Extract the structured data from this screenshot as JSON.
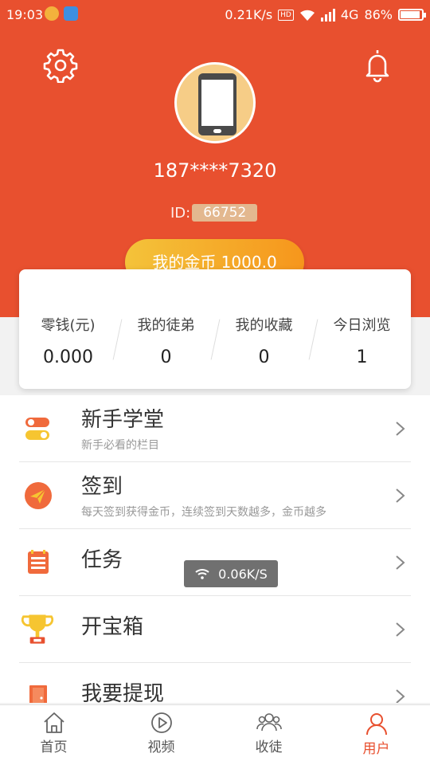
{
  "status_bar": {
    "time": "19:03",
    "speed": "0.21K/s",
    "hd": "HD",
    "network": "4G",
    "battery": "86%"
  },
  "profile": {
    "phone": "187****7320",
    "id_label": "ID:",
    "id_value": "66752"
  },
  "coins": {
    "label": "我的金币 1000.0"
  },
  "stats": [
    {
      "label": "零钱(元)",
      "value": "0.000"
    },
    {
      "label": "我的徒弟",
      "value": "0"
    },
    {
      "label": "我的收藏",
      "value": "0"
    },
    {
      "label": "今日浏览",
      "value": "1"
    }
  ],
  "menu": [
    {
      "title": "新手学堂",
      "sub": "新手必看的栏目",
      "icon": "toggle-icon"
    },
    {
      "title": "签到",
      "sub": "每天签到获得金币，连续签到天数越多，金币越多",
      "icon": "paper-plane-icon"
    },
    {
      "title": "任务",
      "sub": "",
      "icon": "task-list-icon"
    },
    {
      "title": "开宝箱",
      "sub": "",
      "icon": "trophy-icon"
    },
    {
      "title": "我要提现",
      "sub": "",
      "icon": "door-icon"
    }
  ],
  "toast": {
    "text": "0.06K/S"
  },
  "nav": [
    {
      "label": "首页",
      "icon": "home-icon"
    },
    {
      "label": "视频",
      "icon": "play-icon"
    },
    {
      "label": "收徒",
      "icon": "group-icon"
    },
    {
      "label": "用户",
      "icon": "user-icon"
    }
  ],
  "colors": {
    "brand": "#e8502f",
    "coin_start": "#f4c33a",
    "coin_end": "#f6961c",
    "active_nav": "#e8502f"
  }
}
